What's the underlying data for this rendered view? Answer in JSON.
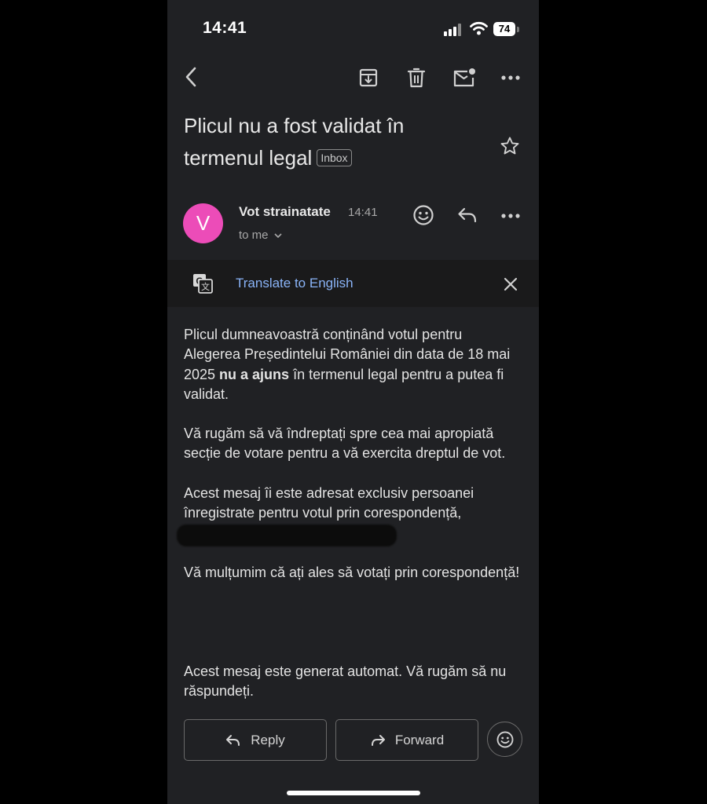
{
  "status_bar": {
    "time": "14:41",
    "battery": "74"
  },
  "email": {
    "subject_line1": "Plicul nu a fost validat în",
    "subject_line2": "termenul legal",
    "label": "Inbox",
    "sender": {
      "initial": "V",
      "name": "Vot strainatate",
      "time": "14:41",
      "recipient": "to me"
    },
    "avatar_color": "#ec4cb8"
  },
  "translate": {
    "label": "Translate to English"
  },
  "body": {
    "p1_before": "Plicul dumneavoastră conținând votul pentru Alegerea Președintelui României din data de 18 mai 2025 ",
    "p1_bold": "nu a ajuns",
    "p1_after": " în termenul legal pentru a putea fi validat.",
    "p2": "Vă rugăm să vă îndreptați spre cea mai apropiată secție de votare pentru a vă exercita dreptul de vot.",
    "p3": "Acest mesaj îi este adresat exclusiv persoanei înregistrate pentru votul prin corespondență,",
    "p4": "Vă mulțumim că ați ales să votați prin corespondență!",
    "p5": "Acest mesaj este generat automat. Vă rugăm să nu răspundeți."
  },
  "actions": {
    "reply": "Reply",
    "forward": "Forward"
  },
  "icons": [
    "back-icon",
    "archive-icon",
    "delete-icon",
    "mark-unread-icon",
    "more-icon",
    "star-icon",
    "emoji-icon",
    "reply-icon",
    "translate-icon",
    "close-icon",
    "forward-icon"
  ],
  "colors": {
    "link": "#8ab4f8",
    "background": "#202124"
  }
}
